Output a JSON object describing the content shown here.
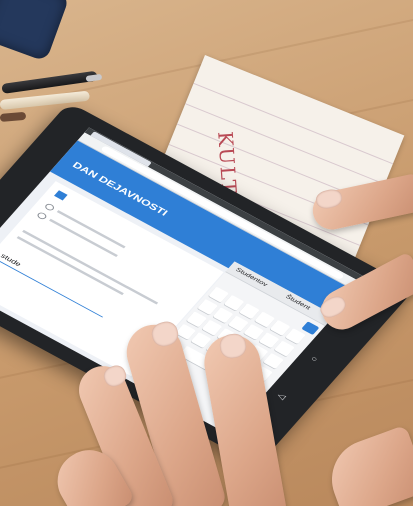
{
  "notebook": {
    "handwriting": "KULTURNA DAN"
  },
  "tablet": {
    "page_title": "DAN DEJAVNOSTI",
    "input_value": "stude",
    "suggestions": [
      "Studentov",
      "Študent"
    ]
  }
}
